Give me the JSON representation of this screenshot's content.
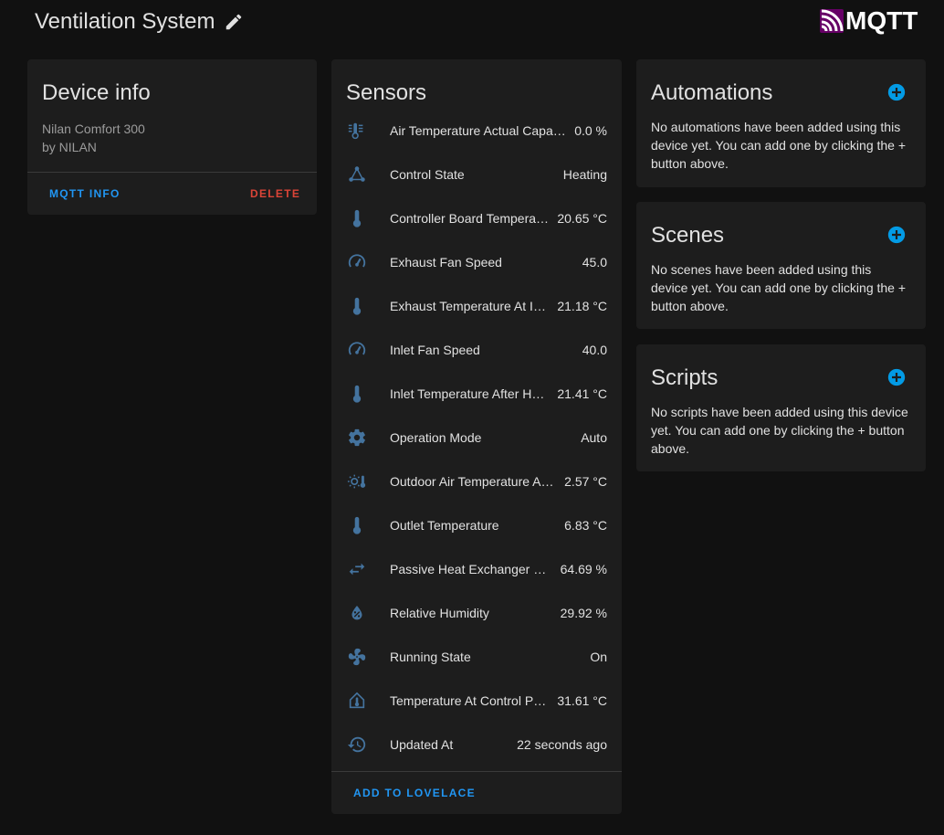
{
  "header": {
    "title": "Ventilation System",
    "logo_text": "MQTT"
  },
  "device_info": {
    "title": "Device info",
    "model": "Nilan Comfort 300",
    "manufacturer": "by NILAN",
    "mqtt_info_label": "MQTT INFO",
    "delete_label": "DELETE"
  },
  "sensors": {
    "title": "Sensors",
    "items": [
      {
        "name": "Air Temperature Actual Capacity",
        "value": "0.0 %",
        "icon": "thermometer-lines-icon"
      },
      {
        "name": "Control State",
        "value": "Heating",
        "icon": "state-machine-icon"
      },
      {
        "name": "Controller Board Temperature",
        "value": "20.65 °C",
        "icon": "thermometer-icon"
      },
      {
        "name": "Exhaust Fan Speed",
        "value": "45.0",
        "icon": "speedometer-icon"
      },
      {
        "name": "Exhaust Temperature At Intake",
        "value": "21.18 °C",
        "icon": "thermometer-icon"
      },
      {
        "name": "Inlet Fan Speed",
        "value": "40.0",
        "icon": "speedometer-icon"
      },
      {
        "name": "Inlet Temperature After Heater",
        "value": "21.41 °C",
        "icon": "thermometer-icon"
      },
      {
        "name": "Operation Mode",
        "value": "Auto",
        "icon": "gear-icon"
      },
      {
        "name": "Outdoor Air Temperature At Intake",
        "value": "2.57 °C",
        "icon": "sun-thermometer-icon"
      },
      {
        "name": "Outlet Temperature",
        "value": "6.83 °C",
        "icon": "thermometer-icon"
      },
      {
        "name": "Passive Heat Exchanger Efficiency",
        "value": "64.69 %",
        "icon": "swap-arrows-icon"
      },
      {
        "name": "Relative Humidity",
        "value": "29.92 %",
        "icon": "water-percent-icon"
      },
      {
        "name": "Running State",
        "value": "On",
        "icon": "fan-icon"
      },
      {
        "name": "Temperature At Control Panel",
        "value": "31.61 °C",
        "icon": "home-thermometer-icon"
      },
      {
        "name": "Updated At",
        "value": "22 seconds ago",
        "icon": "history-icon"
      }
    ],
    "add_to_lovelace_label": "ADD TO LOVELACE"
  },
  "automations": {
    "title": "Automations",
    "text": "No automations have been added using this device yet. You can add one by clicking the + button above."
  },
  "scenes": {
    "title": "Scenes",
    "text": "No scenes have been added using this device yet. You can add one by clicking the + button above."
  },
  "scripts": {
    "title": "Scripts",
    "text": "No scripts have been added using this device yet. You can add one by clicking the + button above."
  },
  "colors": {
    "background": "#111111",
    "card": "#1d1d1d",
    "accent_blue": "#2196f3",
    "add_icon_blue": "#039be5",
    "delete_red": "#db4437",
    "icon": "#44739e",
    "logo_purple": "#660066"
  }
}
